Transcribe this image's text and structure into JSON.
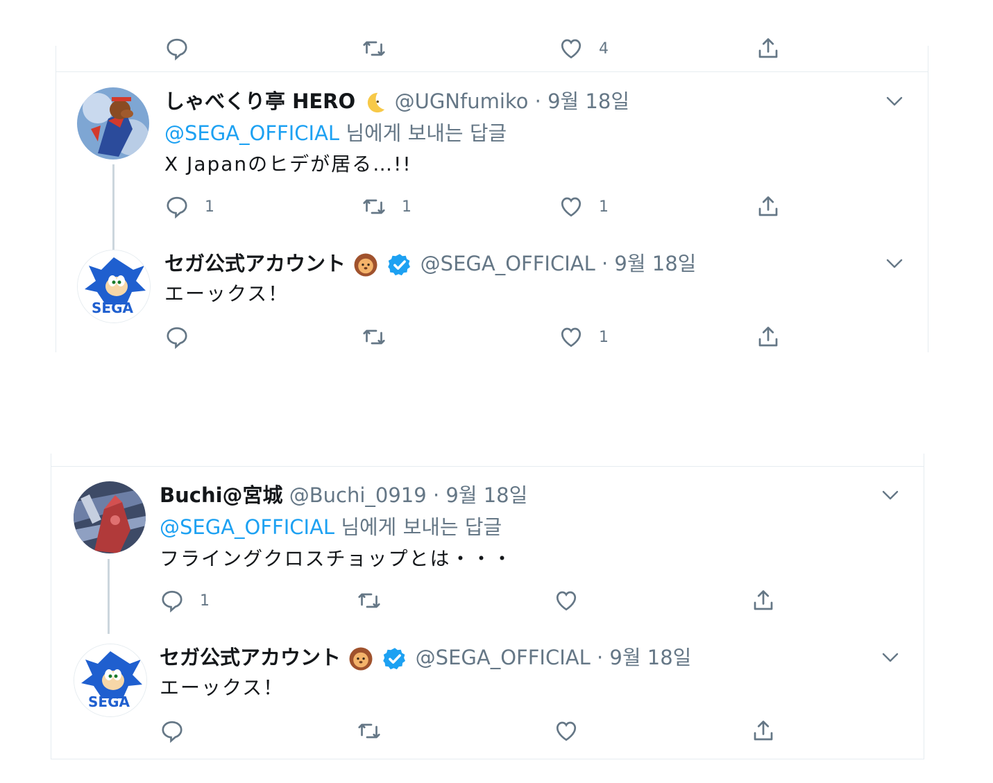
{
  "reply_label": "님에게 보내는 답글",
  "threads": [
    {
      "reply": {
        "name": "しゃべくり亭 HERO",
        "name_emoji": "crescent-moon-icon",
        "handle": "@UGNfumiko",
        "date": "9월 18일",
        "reply_to": "@SEGA_OFFICIAL",
        "text": "X Japanのヒデが居る…!!",
        "counts": {
          "reply": "1",
          "retweet": "1",
          "like": "1"
        }
      },
      "sega": {
        "name": "セガ公式アカウント",
        "handle": "@SEGA_OFFICIAL",
        "date": "9월 18일",
        "text": "エーックス！",
        "counts": {
          "reply": "",
          "retweet": "",
          "like": "1"
        }
      }
    },
    {
      "reply": {
        "name": "Buchi@宮城",
        "handle": "@Buchi_0919",
        "date": "9월 18일",
        "reply_to": "@SEGA_OFFICIAL",
        "text": "フライングクロスチョップとは・・・",
        "counts": {
          "reply": "1",
          "retweet": "",
          "like": ""
        }
      },
      "sega": {
        "name": "セガ公式アカウント",
        "handle": "@SEGA_OFFICIAL",
        "date": "9월 18일",
        "text": "エーックス！",
        "counts": {
          "reply": "",
          "retweet": "",
          "like": ""
        }
      }
    }
  ],
  "prev_tweet_counts": {
    "like": "4"
  },
  "colors": {
    "link": "#1da1f2",
    "secondary": "#657786",
    "verified": "#1da1f2",
    "border": "#e6ecf0"
  }
}
